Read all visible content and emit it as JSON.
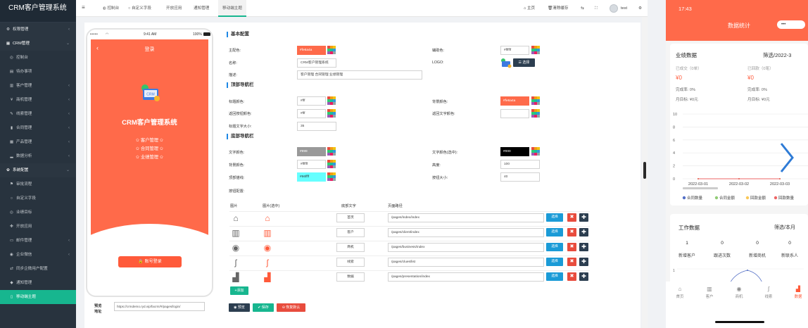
{
  "sidebar": {
    "title": "CRM客户管理系统",
    "items": [
      {
        "label": "权限管理",
        "icon": "shield-icon",
        "glyph": "⚙",
        "arrow": "‹"
      },
      {
        "label": "CRM管理",
        "icon": "grid-icon",
        "glyph": "▦",
        "arrow": "⌄"
      },
      {
        "label": "控制台",
        "icon": "dashboard-icon",
        "glyph": "◎",
        "arrow": ""
      },
      {
        "label": "待办事项",
        "icon": "calendar-icon",
        "glyph": "▤",
        "arrow": ""
      },
      {
        "label": "客户管理",
        "icon": "users-icon",
        "glyph": "▥",
        "arrow": "‹"
      },
      {
        "label": "商机管理",
        "icon": "yen-icon",
        "glyph": "¥",
        "arrow": "‹"
      },
      {
        "label": "线索管理",
        "icon": "link-icon",
        "glyph": "✎",
        "arrow": "‹"
      },
      {
        "label": "合同管理",
        "icon": "bookmark-icon",
        "glyph": "▮",
        "arrow": "‹"
      },
      {
        "label": "产品管理",
        "icon": "product-icon",
        "glyph": "▦",
        "arrow": "‹"
      },
      {
        "label": "数据分析",
        "icon": "chart-icon",
        "glyph": "▂",
        "arrow": "‹"
      },
      {
        "label": "系统配置",
        "icon": "cogs-icon",
        "glyph": "✿",
        "arrow": "⌄"
      },
      {
        "label": "审批流程",
        "icon": "flow-icon",
        "glyph": "⚑",
        "arrow": ""
      },
      {
        "label": "自定义字段",
        "icon": "circle-icon",
        "glyph": "○",
        "arrow": ""
      },
      {
        "label": "业绩目标",
        "icon": "target-icon",
        "glyph": "◎",
        "arrow": ""
      },
      {
        "label": "开放应用",
        "icon": "apps-icon",
        "glyph": "✤",
        "arrow": ""
      },
      {
        "label": "邮件管理",
        "icon": "mail-icon",
        "glyph": "▭",
        "arrow": "‹"
      },
      {
        "label": "企业微信",
        "icon": "wechat-icon",
        "glyph": "◉",
        "arrow": "‹"
      },
      {
        "label": "同步企微用户配置",
        "icon": "sync-icon",
        "glyph": "⇄",
        "arrow": ""
      },
      {
        "label": "通知管理",
        "icon": "bell-icon",
        "glyph": "◆",
        "arrow": ""
      },
      {
        "label": "移动端主题",
        "icon": "mobile-icon",
        "glyph": "▯",
        "arrow": ""
      }
    ]
  },
  "topbar": {
    "menu_glyph": "≡",
    "tabs": [
      {
        "label": "控制台",
        "glyph": "◍"
      },
      {
        "label": "自定义字段",
        "glyph": "○"
      },
      {
        "label": "开放应用",
        "glyph": ""
      },
      {
        "label": "通知管理",
        "glyph": ""
      },
      {
        "label": "移动端主题",
        "glyph": ""
      }
    ],
    "right": {
      "home": "主页",
      "clear_cache": "清除缓存",
      "user": "test"
    }
  },
  "phone": {
    "status": {
      "carrier": "•••••",
      "wifi": "◠",
      "time": "9:41 AM",
      "battery": "100%"
    },
    "title": "登录",
    "back": "‹",
    "app_name": "CRM客户管理系统",
    "logo_text": "CRM",
    "features": [
      "✩ 客户管理 ✩",
      "✩ 合同管理 ✩",
      "✩ 业绩管理 ✩"
    ],
    "login_button": "账号登录",
    "preview_label": "预览\n地址",
    "preview_url": "https://crmdemo.ryd.vip/facrm/#/pages/login/"
  },
  "basic": {
    "section_title": "基本配置",
    "primary_color_label": "主配色:",
    "primary_color": "#fe6a4a",
    "primary_color_value": "#fe6a4a",
    "secondary_color_label": "辅助色:",
    "secondary_color_value": "#ffffff",
    "name_label": "名称:",
    "name_value": "CRM客户管理系统",
    "logo_label": "LOGO:",
    "select_label": "选择",
    "desc_label": "描述:",
    "desc_value": "客户管理 合同管理 业绩管理"
  },
  "topnav": {
    "section_title": "顶部导航栏",
    "title_color_label": "标题颜色:",
    "title_color_value": "#fff",
    "bg_color_label": "背景颜色:",
    "bg_color": "#fe6a4a",
    "bg_color_value": "#fe6a4a",
    "back_btn_color_label": "返回按钮颜色:",
    "back_btn_color_value": "#fff",
    "back_text_color_label": "返回文字颜色:",
    "title_font_size_label": "标题文字大小:",
    "title_font_size_value": "35"
  },
  "bottomnav": {
    "section_title": "底部导航栏",
    "text_color_label": "文字颜色:",
    "text_color": "#999999",
    "text_color_value": "#999",
    "text_color_selected_label": "文字颜色(选中):",
    "text_color_selected": "#000000",
    "text_color_selected_value": "#000",
    "bg_color_label": "背景颜色:",
    "bg_color_value": "#ffffff",
    "height_label": "高度:",
    "height_value": "100",
    "top_border_label": "顶部描线:",
    "top_border_color": "#66ffff",
    "top_border_value": "#66ffff",
    "btn_size_label": "按钮大小:",
    "btn_size_value": "40",
    "button_config_label": "按钮配置:"
  },
  "table": {
    "headers": [
      "图片",
      "图片(选中)",
      "底部文字",
      "页面路径"
    ],
    "rows": [
      {
        "icon": "home-icon",
        "icon_glyph": "⌂",
        "sel_glyph": "⌂",
        "text": "首页",
        "path": "/pages/index/index"
      },
      {
        "icon": "customer-icon",
        "icon_glyph": "▥",
        "sel_glyph": "▥",
        "text": "客户",
        "path": "/pages/client/index"
      },
      {
        "icon": "business-icon",
        "icon_glyph": "◉",
        "sel_glyph": "◉",
        "text": "商机",
        "path": "/pages/business/index"
      },
      {
        "icon": "clues-icon",
        "icon_glyph": "ʃ",
        "sel_glyph": "ʃ",
        "text": "线索",
        "path": "/pages/clues/list"
      },
      {
        "icon": "data-icon",
        "icon_glyph": "▟",
        "sel_glyph": "▟",
        "text": "数据",
        "path": "/pages/presentation/index"
      }
    ],
    "select_label": "选择",
    "delete_glyph": "✖",
    "move_glyph": "✚",
    "add_label": "+添加"
  },
  "actions": {
    "preview": "◉ 预览",
    "save": "✔ 保存",
    "reset": "⊖ 恢复默认"
  },
  "mobile": {
    "time": "17:43",
    "title": "数据统计",
    "pill": "•••",
    "perf": {
      "title": "业绩数据",
      "filter": "筛选/2022-3",
      "closed_label": "已成交（0单）",
      "received_label": "已回款（0笔）",
      "closed_value": "¥0",
      "received_value": "¥0",
      "rate_label_1": "完成率: 0%",
      "rate_label_2": "完成率: 0%",
      "target_1": "月目标: ¥0元",
      "target_2": "月目标: ¥0元"
    },
    "chart": {
      "y_ticks": [
        "10",
        "8",
        "6",
        "4",
        "2",
        "0"
      ],
      "x_ticks": [
        "2022-03-01",
        "2022-03-02",
        "2022-03-03"
      ],
      "legend": [
        "合同数量",
        "合同金额",
        "回款金额",
        "回款数量"
      ],
      "legend_colors": [
        "#5470c6",
        "#91cc75",
        "#fac858",
        "#ee6666"
      ]
    },
    "chart_data": {
      "type": "line",
      "x": [
        "2022-03-01",
        "2022-03-02",
        "2022-03-03"
      ],
      "series": [
        {
          "name": "合同数量",
          "values": [
            0,
            0,
            0
          ]
        },
        {
          "name": "合同金额",
          "values": [
            0,
            0,
            0
          ]
        },
        {
          "name": "回款金额",
          "values": [
            0,
            0,
            0
          ]
        },
        {
          "name": "回款数量",
          "values": [
            0,
            0,
            0
          ]
        }
      ],
      "ylim": [
        0,
        10
      ],
      "legend": "bottom"
    },
    "work": {
      "title": "工作数据",
      "filter": "筛选/本月",
      "values": [
        "1",
        "0",
        "0",
        "0"
      ],
      "labels": [
        "新增客户",
        "跟进次数",
        "新增商机",
        "新联系人"
      ]
    },
    "nav": [
      "首页",
      "客户",
      "商机",
      "线索",
      "数据"
    ],
    "nav_glyphs": [
      "⌂",
      "▥",
      "◉",
      "ʃ",
      "▟"
    ]
  }
}
